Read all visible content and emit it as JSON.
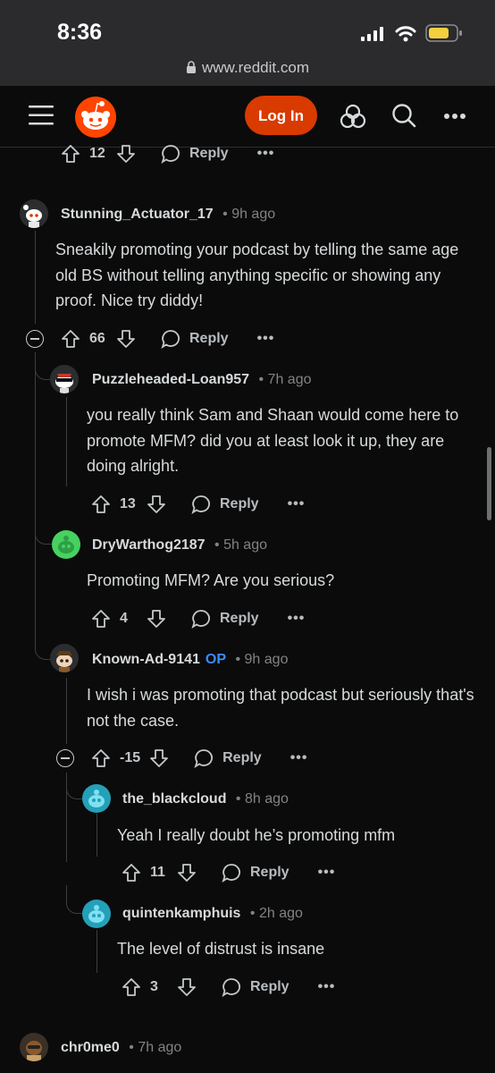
{
  "status_bar": {
    "time": "8:36",
    "url": "www.reddit.com"
  },
  "header": {
    "login_label": "Log In"
  },
  "top_actions": {
    "score": "12",
    "reply_label": "Reply",
    "more": "•••"
  },
  "comments": [
    {
      "user": "Stunning_Actuator_17",
      "op": "",
      "time": "9h ago",
      "body": "Sneakily promoting your podcast by telling the same age old BS without telling anything specific or showing any proof. Nice try diddy!",
      "score": "66",
      "reply_label": "Reply",
      "more": "•••"
    },
    {
      "user": "Puzzleheaded-Loan957",
      "op": "",
      "time": "7h ago",
      "body": "you really think Sam and Shaan would come here to promote MFM? did you at least look it up, they are doing alright.",
      "score": "13",
      "reply_label": "Reply",
      "more": "•••"
    },
    {
      "user": "DryWarthog2187",
      "op": "",
      "time": "5h ago",
      "body": "Promoting MFM? Are you serious?",
      "score": "4",
      "reply_label": "Reply",
      "more": "•••"
    },
    {
      "user": "Known-Ad-9141",
      "op": "OP",
      "time": "9h ago",
      "body": "I wish i was promoting that podcast but seriously that's not the case.",
      "score": "-15",
      "reply_label": "Reply",
      "more": "•••"
    },
    {
      "user": "the_blackcloud",
      "op": "",
      "time": "8h ago",
      "body": "Yeah I really doubt he’s promoting mfm",
      "score": "11",
      "reply_label": "Reply",
      "more": "•••"
    },
    {
      "user": "quintenkamphuis",
      "op": "",
      "time": "2h ago",
      "body": "The level of distrust is insane",
      "score": "3",
      "reply_label": "Reply",
      "more": "•••"
    },
    {
      "user": "chr0me0",
      "op": "",
      "time": "7h ago"
    }
  ],
  "colors": {
    "accent": "#d93a00",
    "op": "#3a8bff",
    "background": "#0b0b0b"
  }
}
